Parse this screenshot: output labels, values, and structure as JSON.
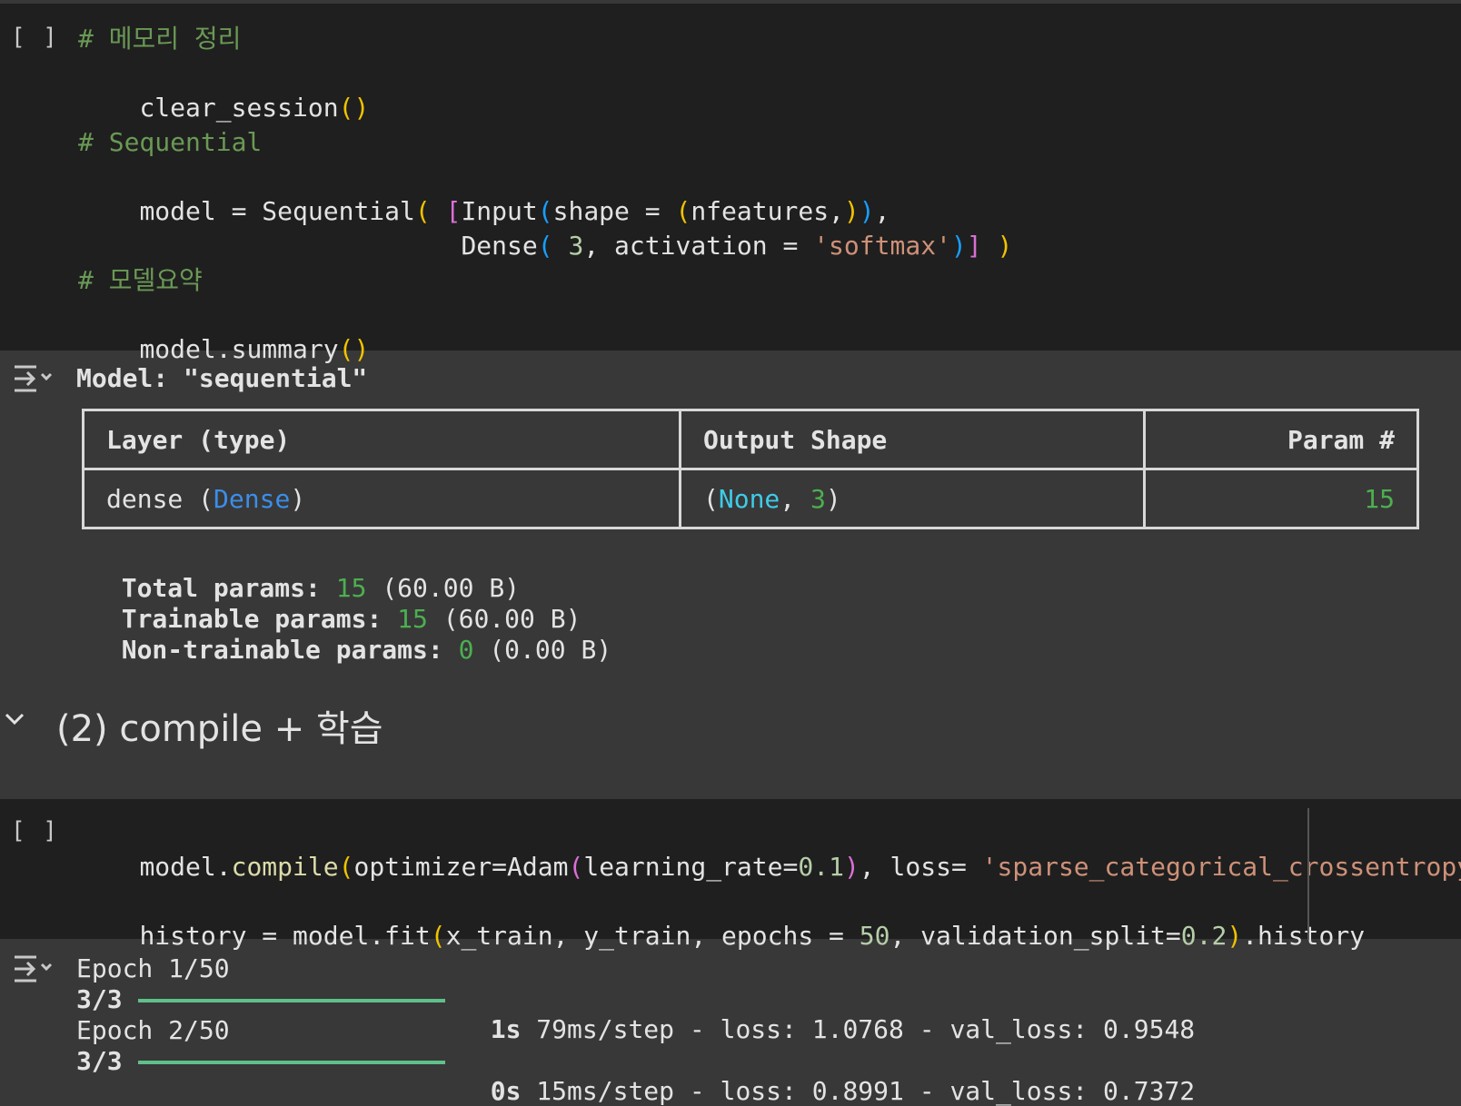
{
  "cell1": {
    "run_bracket": "[ ]",
    "lines": {
      "c1": "# 메모리 정리",
      "l1": "clear_session()",
      "c2": "# Sequential",
      "l2a": "model = Sequential(",
      "l2b": "[Input(shape = (nfeatures,)),",
      "l3a": "Dense(",
      "l3b": "3, activation = ",
      "l3c": "'softmax'",
      "l3d": ")] )",
      "c3": "# 모델요약",
      "l4": "model.summary()"
    }
  },
  "output1": {
    "model_title": "Model: \"sequential\"",
    "table": {
      "headers": [
        "Layer (type)",
        "Output Shape",
        "Param #"
      ],
      "rows": [
        {
          "layer": "dense",
          "layer_type": "Dense",
          "shape_none": "None",
          "shape_dim": "3",
          "params": "15"
        }
      ]
    },
    "totals": [
      {
        "label": "Total params:",
        "value": "15",
        "size": "(60.00 B)"
      },
      {
        "label": "Trainable params:",
        "value": "15",
        "size": "(60.00 B)"
      },
      {
        "label": "Non-trainable params:",
        "value": "0",
        "size": "(0.00 B)"
      }
    ]
  },
  "section": {
    "title": "(2) compile + 학습"
  },
  "cell2": {
    "run_bracket": "[ ]",
    "line1": {
      "a": "model.",
      "fn": "compile",
      "b": "optimizer=Adam",
      "c": "learning_rate=",
      "num": "0.1",
      "d": ", loss= ",
      "str": "'sparse_categorical_crossentropy'"
    },
    "line2": {
      "a": "history = model.fit",
      "b": "x_train, y_train, epochs = ",
      "num1": "50",
      "c": ", validation_split=",
      "num2": "0.2",
      "d": ".history"
    }
  },
  "output2": {
    "epochs": [
      {
        "epoch": "Epoch 1/50",
        "steps": "3/3",
        "time": "1s",
        "rest": "79ms/step - loss: 1.0768 - val_loss: 0.9548",
        "progress": 1.0
      },
      {
        "epoch": "Epoch 2/50",
        "steps": "3/3",
        "time": "0s",
        "rest": "15ms/step - loss: 0.8991 - val_loss: 0.7372",
        "progress": 1.0
      }
    ]
  },
  "colors": {
    "cell_bg": "#1f1f1f",
    "output_bg": "#383838",
    "comment": "#6a9955",
    "string": "#ce9178",
    "number_green": "#4caf50",
    "progress": "#5fc08a"
  }
}
